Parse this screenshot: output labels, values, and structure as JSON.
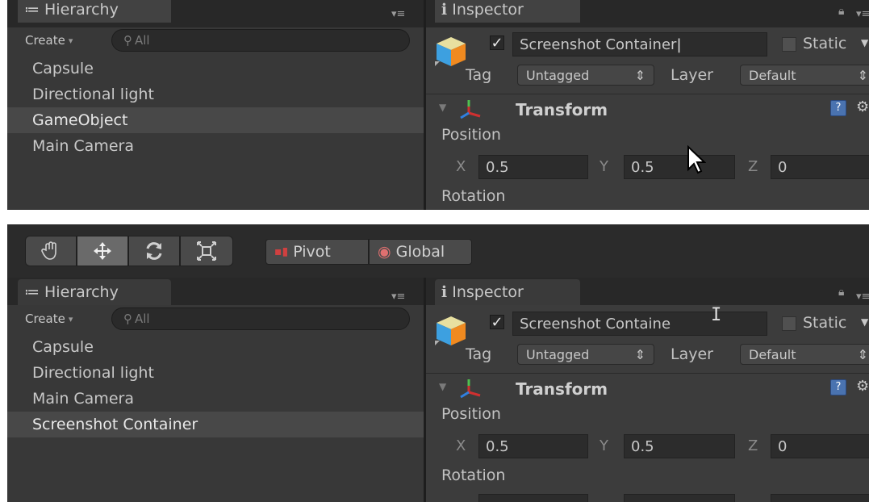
{
  "top": {
    "hierarchy": {
      "tab_label": "Hierarchy",
      "menu_glyph": "▾≡",
      "create_label": "Create",
      "create_arrow": "▾",
      "search_placeholder": "All",
      "items": [
        {
          "label": "Capsule",
          "selected": false
        },
        {
          "label": "Directional light",
          "selected": false
        },
        {
          "label": "GameObject",
          "selected": true
        },
        {
          "label": "Main Camera",
          "selected": false
        }
      ]
    },
    "inspector": {
      "tab_label": "Inspector",
      "name_value": "Screenshot Container",
      "static_label": "Static",
      "tag_label": "Tag",
      "tag_value": "Untagged",
      "layer_label": "Layer",
      "layer_value": "Default",
      "component_label": "Transform",
      "position_label": "Position",
      "x_label": "X",
      "x_value": "0.5",
      "y_label": "Y",
      "y_value": "0.5",
      "z_label": "Z",
      "z_value": "0",
      "rotation_label": "Rotation"
    }
  },
  "bottom": {
    "toolbar": {
      "tools": [
        "hand-icon",
        "move-icon",
        "rotate-icon",
        "scale-icon"
      ],
      "pivot_label": "Pivot",
      "global_label": "Global"
    },
    "hierarchy": {
      "tab_label": "Hierarchy",
      "menu_glyph": "▾≡",
      "create_label": "Create",
      "create_arrow": "▾",
      "search_placeholder": "All",
      "items": [
        {
          "label": "Capsule",
          "selected": false
        },
        {
          "label": "Directional light",
          "selected": false
        },
        {
          "label": "Main Camera",
          "selected": false
        },
        {
          "label": "Screenshot Container",
          "selected": true
        }
      ]
    },
    "inspector": {
      "tab_label": "Inspector",
      "name_value": "Screenshot Containe",
      "static_label": "Static",
      "tag_label": "Tag",
      "tag_value": "Untagged",
      "layer_label": "Layer",
      "layer_value": "Default",
      "component_label": "Transform",
      "position_label": "Position",
      "x_label": "X",
      "x_value": "0.5",
      "y_label": "Y",
      "y_value": "0.5",
      "z_label": "Z",
      "z_value": "0",
      "rotation_label": "Rotation"
    }
  },
  "colors": {
    "panel_bg": "#383838",
    "selection_bg": "#484848",
    "help_blue": "#4a73b0"
  }
}
